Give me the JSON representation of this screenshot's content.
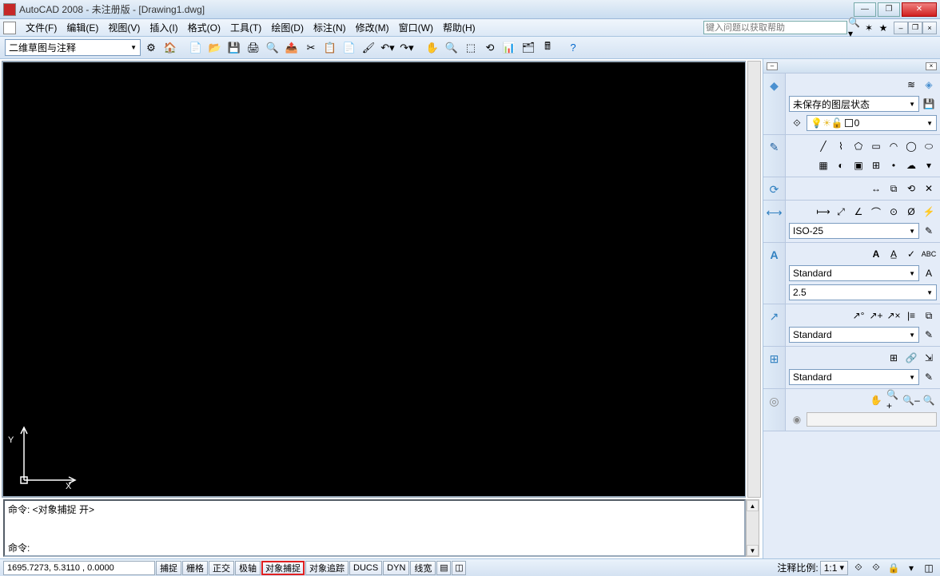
{
  "title": "AutoCAD 2008 - 未注册版 - [Drawing1.dwg]",
  "menubar": {
    "file": "文件(F)",
    "edit": "编辑(E)",
    "view": "视图(V)",
    "insert": "插入(I)",
    "format": "格式(O)",
    "tools": "工具(T)",
    "draw": "绘图(D)",
    "dimension": "标注(N)",
    "modify": "修改(M)",
    "window": "窗口(W)",
    "help": "帮助(H)",
    "help_placeholder": "键入问题以获取帮助"
  },
  "toolbar": {
    "workspace": "二维草图与注释"
  },
  "command": {
    "history": "命令:  <对象捕捉 开>",
    "prompt": "命令:"
  },
  "status": {
    "coords": "1695.7273, 5.3110  , 0.0000",
    "snap": "捕捉",
    "grid": "栅格",
    "ortho": "正交",
    "polar": "极轴",
    "osnap": "对象捕捉",
    "otrack": "对象追踪",
    "ducs": "DUCS",
    "dyn": "DYN",
    "lwt": "线宽",
    "ann_label": "注释比例:",
    "ann_scale": "1:1"
  },
  "panels": {
    "layers": {
      "state": "未保存的图层状态",
      "layer0": "0"
    },
    "dim_style": "ISO-25",
    "text_style": "Standard",
    "text_height": "2.5",
    "mleader_style": "Standard",
    "table_style": "Standard"
  },
  "ucs": {
    "x": "X",
    "y": "Y"
  }
}
